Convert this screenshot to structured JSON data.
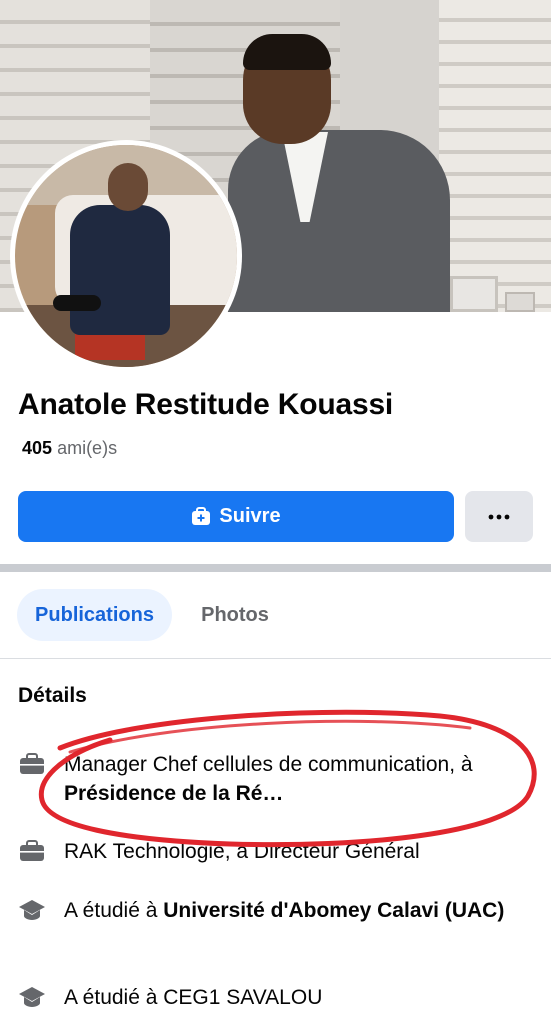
{
  "profile": {
    "name": "Anatole Restitude Kouassi",
    "friends_count": "405",
    "friends_label": "ami(e)s"
  },
  "actions": {
    "follow_label": "Suivre",
    "more_label": "···"
  },
  "tabs": [
    {
      "label": "Publications",
      "active": true
    },
    {
      "label": "Photos",
      "active": false
    }
  ],
  "details": {
    "title": "Détails",
    "items": [
      {
        "icon": "briefcase-icon",
        "prefix": "Manager Chef cellules de communication, à ",
        "bold": "Présidence de la Ré…",
        "suffix": ""
      },
      {
        "icon": "briefcase-icon",
        "prefix": "RAK Technologie, à Directeur Général",
        "bold": "",
        "suffix": ""
      },
      {
        "icon": "graduation-cap-icon",
        "prefix": "A étudié à ",
        "bold": "Université d'Abomey Calavi (UAC)",
        "suffix": ""
      },
      {
        "icon": "graduation-cap-icon",
        "prefix": "A étudié à CEG1 SAVALOU",
        "bold": "",
        "suffix": ""
      }
    ]
  },
  "colors": {
    "accent": "#1877f2",
    "tab_active_bg": "#ebf3ff",
    "tab_active_text": "#1664d9",
    "annotation": "#e0262d"
  }
}
